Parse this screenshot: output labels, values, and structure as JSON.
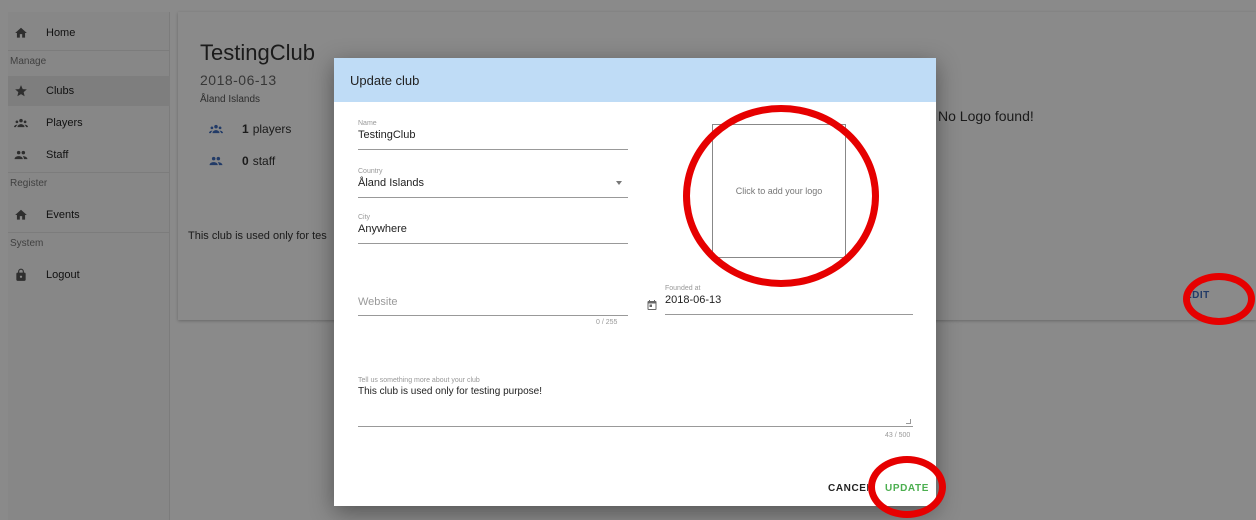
{
  "sidebar": {
    "items": [
      {
        "label": "Home",
        "icon": "home-icon"
      },
      {
        "label": "Clubs",
        "icon": "star-icon"
      },
      {
        "label": "Players",
        "icon": "group-icon"
      },
      {
        "label": "Staff",
        "icon": "people-icon"
      },
      {
        "label": "Events",
        "icon": "home-icon"
      },
      {
        "label": "Logout",
        "icon": "lock-icon"
      }
    ],
    "sections": [
      "Manage",
      "Register",
      "System"
    ]
  },
  "club": {
    "name": "TestingClub",
    "date": "2018-06-13",
    "country": "Åland Islands",
    "players_count": "1",
    "players_label": "players",
    "staff_count": "0",
    "staff_label": "staff",
    "description_excerpt": "This club is used only for tes",
    "no_logo": "No Logo found!",
    "edit_label": "EDIT"
  },
  "dialog": {
    "title": "Update club",
    "name_label": "Name",
    "name_value": "TestingClub",
    "country_label": "Country",
    "country_value": "Åland Islands",
    "city_label": "City",
    "city_value": "Anywhere",
    "website_placeholder": "Website",
    "website_counter": "0 / 255",
    "founded_label": "Founded at",
    "founded_value": "2018-06-13",
    "about_label": "Tell us something more about your club",
    "about_value": "This club is used only for testing purpose!",
    "about_counter": "43 / 500",
    "logo_prompt": "Click to add your logo",
    "cancel_label": "CANCEL",
    "update_label": "UPDATE"
  },
  "colors": {
    "accent_blue": "#3f6dbf",
    "dialog_header": "#bfdcf6",
    "update_green": "#4caf50",
    "annotation_red": "#e60000"
  }
}
